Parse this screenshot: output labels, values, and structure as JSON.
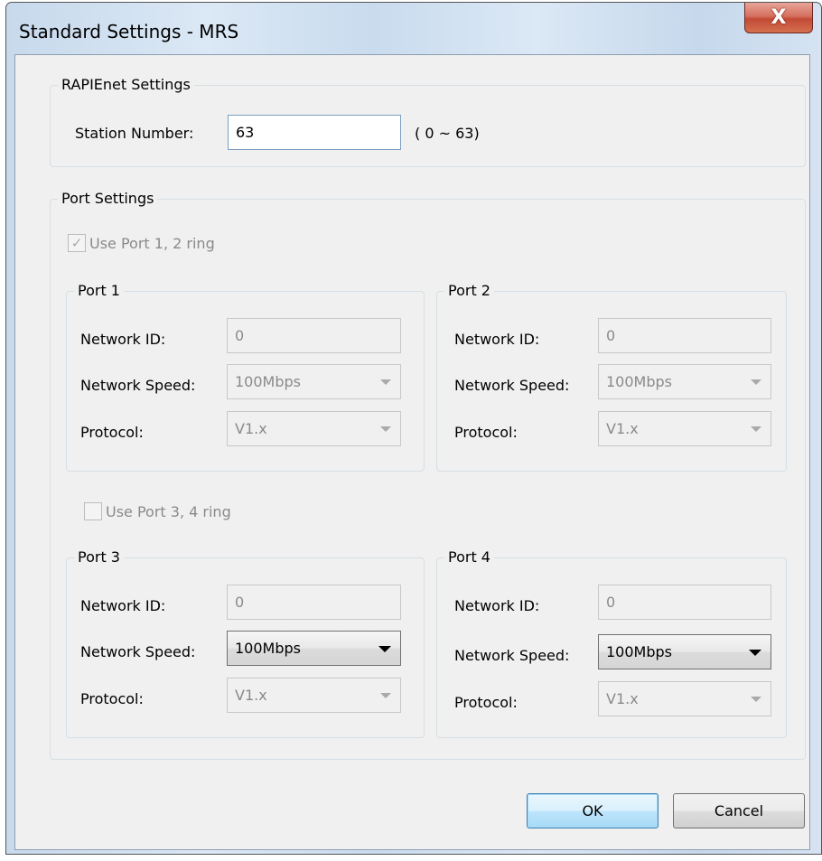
{
  "window": {
    "title": "Standard Settings - MRS",
    "close_glyph": "X"
  },
  "rapienet": {
    "group_label": "RAPIEnet Settings",
    "station_label": "Station Number:",
    "station_value": "63",
    "station_range": "( 0 ~ 63)"
  },
  "port_settings": {
    "group_label": "Port Settings",
    "ring12": {
      "label": "Use Port 1, 2 ring",
      "checked": true,
      "check_glyph": "✓"
    },
    "ring34": {
      "label": "Use Port 3, 4 ring",
      "checked": false,
      "check_glyph": ""
    },
    "ports": [
      {
        "title": "Port 1",
        "network_id_label": "Network ID:",
        "network_id": "0",
        "speed_label": "Network Speed:",
        "speed": "100Mbps",
        "protocol_label": "Protocol:",
        "protocol": "V1.x"
      },
      {
        "title": "Port 2",
        "network_id_label": "Network ID:",
        "network_id": "0",
        "speed_label": "Network Speed:",
        "speed": "100Mbps",
        "protocol_label": "Protocol:",
        "protocol": "V1.x"
      },
      {
        "title": "Port 3",
        "network_id_label": "Network ID:",
        "network_id": "0",
        "speed_label": "Network Speed:",
        "speed": "100Mbps",
        "protocol_label": "Protocol:",
        "protocol": "V1.x"
      },
      {
        "title": "Port 4",
        "network_id_label": "Network ID:",
        "network_id": "0",
        "speed_label": "Network Speed:",
        "speed": "100Mbps",
        "protocol_label": "Protocol:",
        "protocol": "V1.x"
      }
    ]
  },
  "buttons": {
    "ok": "OK",
    "cancel": "Cancel"
  },
  "icons": {
    "close": "close-icon",
    "dropdown": "chevron-down-icon",
    "check": "checkmark-icon"
  }
}
